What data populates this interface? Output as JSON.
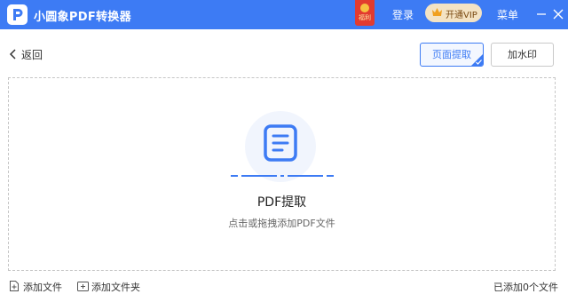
{
  "app": {
    "title": "小圆象PDF转换器",
    "logo_icon": "app-logo-icon",
    "brand_color": "#3d7bf4"
  },
  "titlebar": {
    "gift_label": "福利",
    "login_label": "登录",
    "vip_label": "开通VIP",
    "menu_label": "菜单",
    "minimize_icon": "minimize-icon",
    "close_icon": "close-icon"
  },
  "toolbar": {
    "back_label": "返回",
    "page_extract_label": "页面提取",
    "watermark_label": "加水印"
  },
  "dropzone": {
    "title": "PDF提取",
    "hint": "点击或拖拽添加PDF文件",
    "icon": "document-icon"
  },
  "footer": {
    "add_file_label": "添加文件",
    "add_folder_label": "添加文件夹",
    "file_count_text": "已添加0个文件"
  }
}
